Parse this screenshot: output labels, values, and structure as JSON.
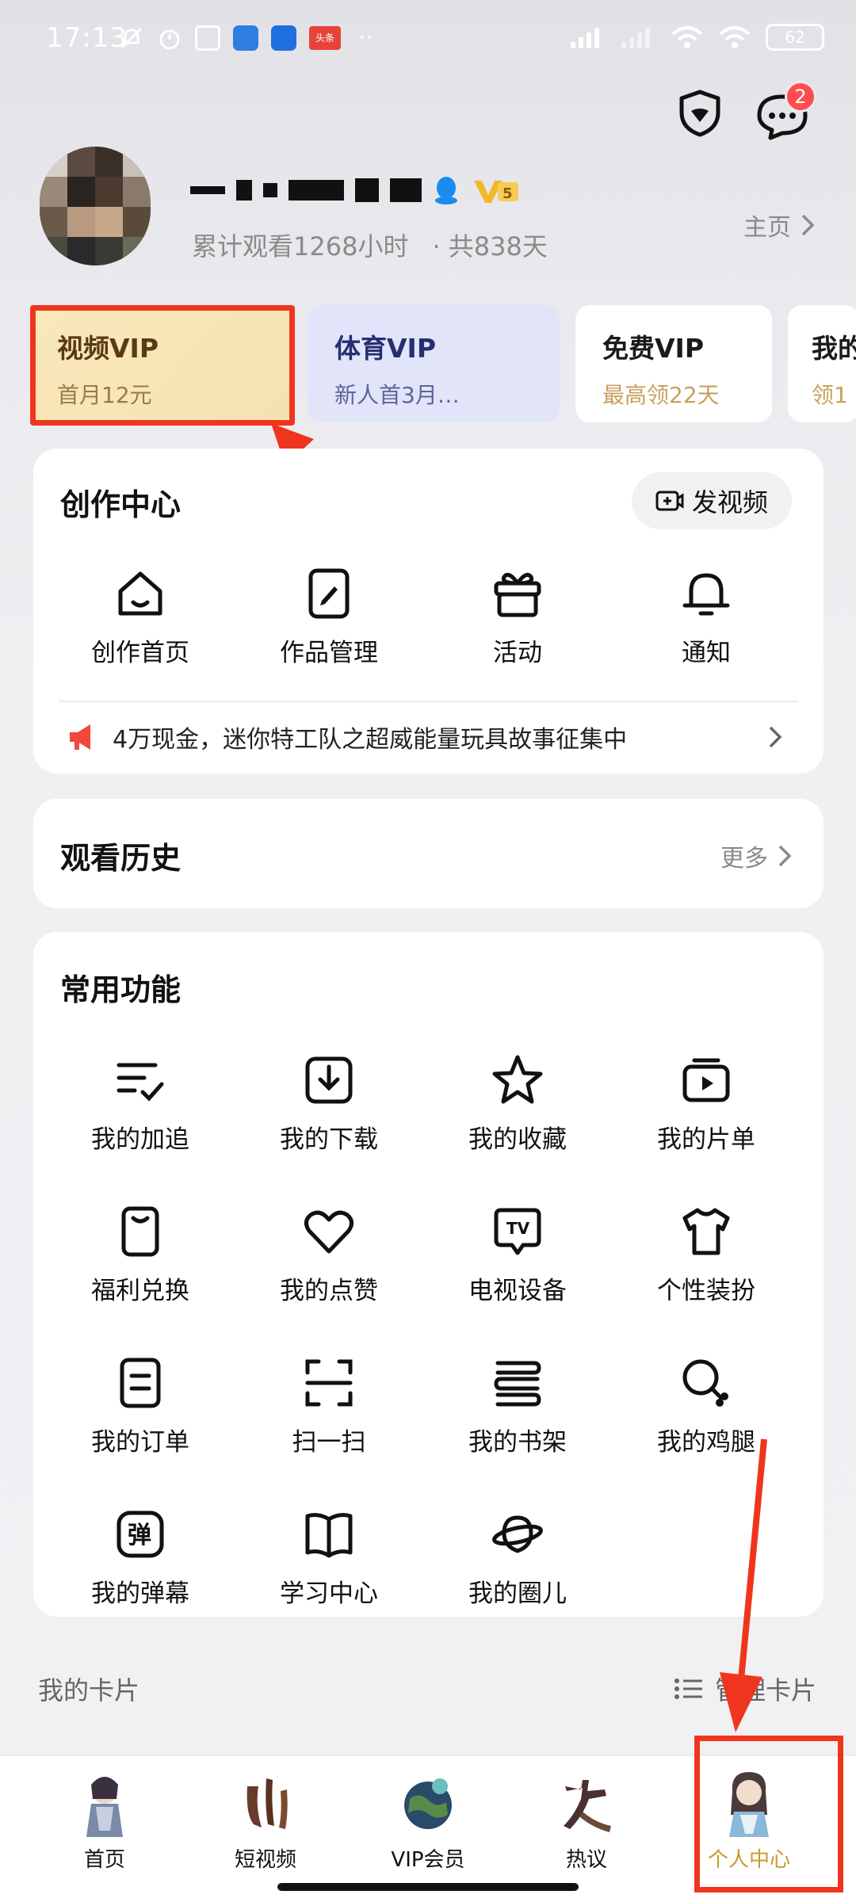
{
  "status_bar": {
    "time": "17:13",
    "battery": "62",
    "headroom_label": "头条"
  },
  "header": {
    "message_badge": "2"
  },
  "profile": {
    "stats_hours": "累计观看1268小时",
    "stats_days": "· 共838天",
    "home_link": "主页"
  },
  "vip_cards": [
    {
      "title": "视频VIP",
      "subtitle": "首月12元"
    },
    {
      "title": "体育VIP",
      "subtitle": "新人首3月…"
    },
    {
      "title": "免费VIP",
      "subtitle": "最高领22天"
    },
    {
      "title": "我的",
      "subtitle": "领1"
    }
  ],
  "creation_center": {
    "title": "创作中心",
    "post_button": "发视频",
    "items": [
      {
        "label": "创作首页",
        "icon": "home-icon"
      },
      {
        "label": "作品管理",
        "icon": "edit-doc-icon"
      },
      {
        "label": "活动",
        "icon": "gift-icon"
      },
      {
        "label": "通知",
        "icon": "bell-icon"
      }
    ],
    "banner_text": "4万现金，迷你特工队之超威能量玩具故事征集中"
  },
  "history": {
    "title": "观看历史",
    "more": "更多"
  },
  "functions": {
    "title": "常用功能",
    "items": [
      {
        "label": "我的加追",
        "icon": "list-check-icon"
      },
      {
        "label": "我的下载",
        "icon": "download-icon"
      },
      {
        "label": "我的收藏",
        "icon": "star-icon"
      },
      {
        "label": "我的片单",
        "icon": "playlist-icon"
      },
      {
        "label": "福利兑换",
        "icon": "welfare-icon"
      },
      {
        "label": "我的点赞",
        "icon": "heart-icon"
      },
      {
        "label": "电视设备",
        "icon": "tv-icon"
      },
      {
        "label": "个性装扮",
        "icon": "shirt-icon"
      },
      {
        "label": "我的订单",
        "icon": "order-icon"
      },
      {
        "label": "扫一扫",
        "icon": "scan-icon"
      },
      {
        "label": "我的书架",
        "icon": "bookshelf-icon"
      },
      {
        "label": "我的鸡腿",
        "icon": "drumstick-icon"
      },
      {
        "label": "我的弹幕",
        "icon": "danmaku-icon"
      },
      {
        "label": "学习中心",
        "icon": "book-icon"
      },
      {
        "label": "我的圈儿",
        "icon": "planet-icon"
      }
    ],
    "danmaku_char": "弹",
    "tv_text": "TV"
  },
  "my_cards": {
    "title": "我的卡片",
    "manage": "管理卡片"
  },
  "bottom_nav": [
    {
      "label": "首页"
    },
    {
      "label": "短视频"
    },
    {
      "label": "VIP会员"
    },
    {
      "label": "热议"
    },
    {
      "label": "个人中心"
    }
  ],
  "colors": {
    "highlight_red": "#f0351e",
    "vip_gold": "#c8a05b",
    "active_tab": "#c79a2a"
  }
}
